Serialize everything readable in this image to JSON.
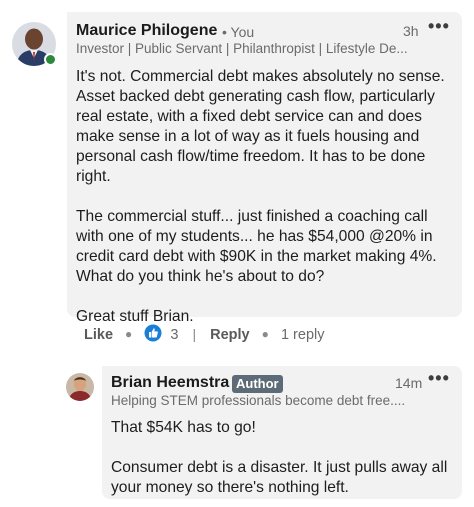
{
  "comment": {
    "author_name": "Maurice Philogene",
    "degree": "• You",
    "time": "3h",
    "more_icon": "more-horizontal-icon",
    "headline": "Investor | Public Servant | Philanthropist | Lifestyle De...",
    "paragraphs": [
      "It's not. Commercial debt makes absolutely no sense. Asset backed debt generating cash flow, particularly real estate, with a fixed debt service can and does make sense in a lot of way as it fuels housing and personal cash flow/time freedom. It has to be done right.",
      "The commercial stuff... just finished a coaching call with one of my students... he has $54,000 @20% in credit card debt with $90K in the market making 4%. What do you think he's about to do?",
      "Great stuff Brian."
    ],
    "online_status_color": "#2a8a3a"
  },
  "actions": {
    "like_label": "Like",
    "reaction_count": "3",
    "reply_label": "Reply",
    "reply_count": "1 reply",
    "like_icon": "thumbs-up-icon",
    "like_icon_color": "#1a7fd6"
  },
  "reply": {
    "author_name": "Brian Heemstra",
    "badge": "Author",
    "time": "14m",
    "more_icon": "more-horizontal-icon",
    "headline": "Helping STEM professionals become debt free....",
    "paragraphs": [
      "That $54K has to go!",
      "Consumer debt is a disaster. It just pulls away all your money so there's nothing left."
    ]
  }
}
